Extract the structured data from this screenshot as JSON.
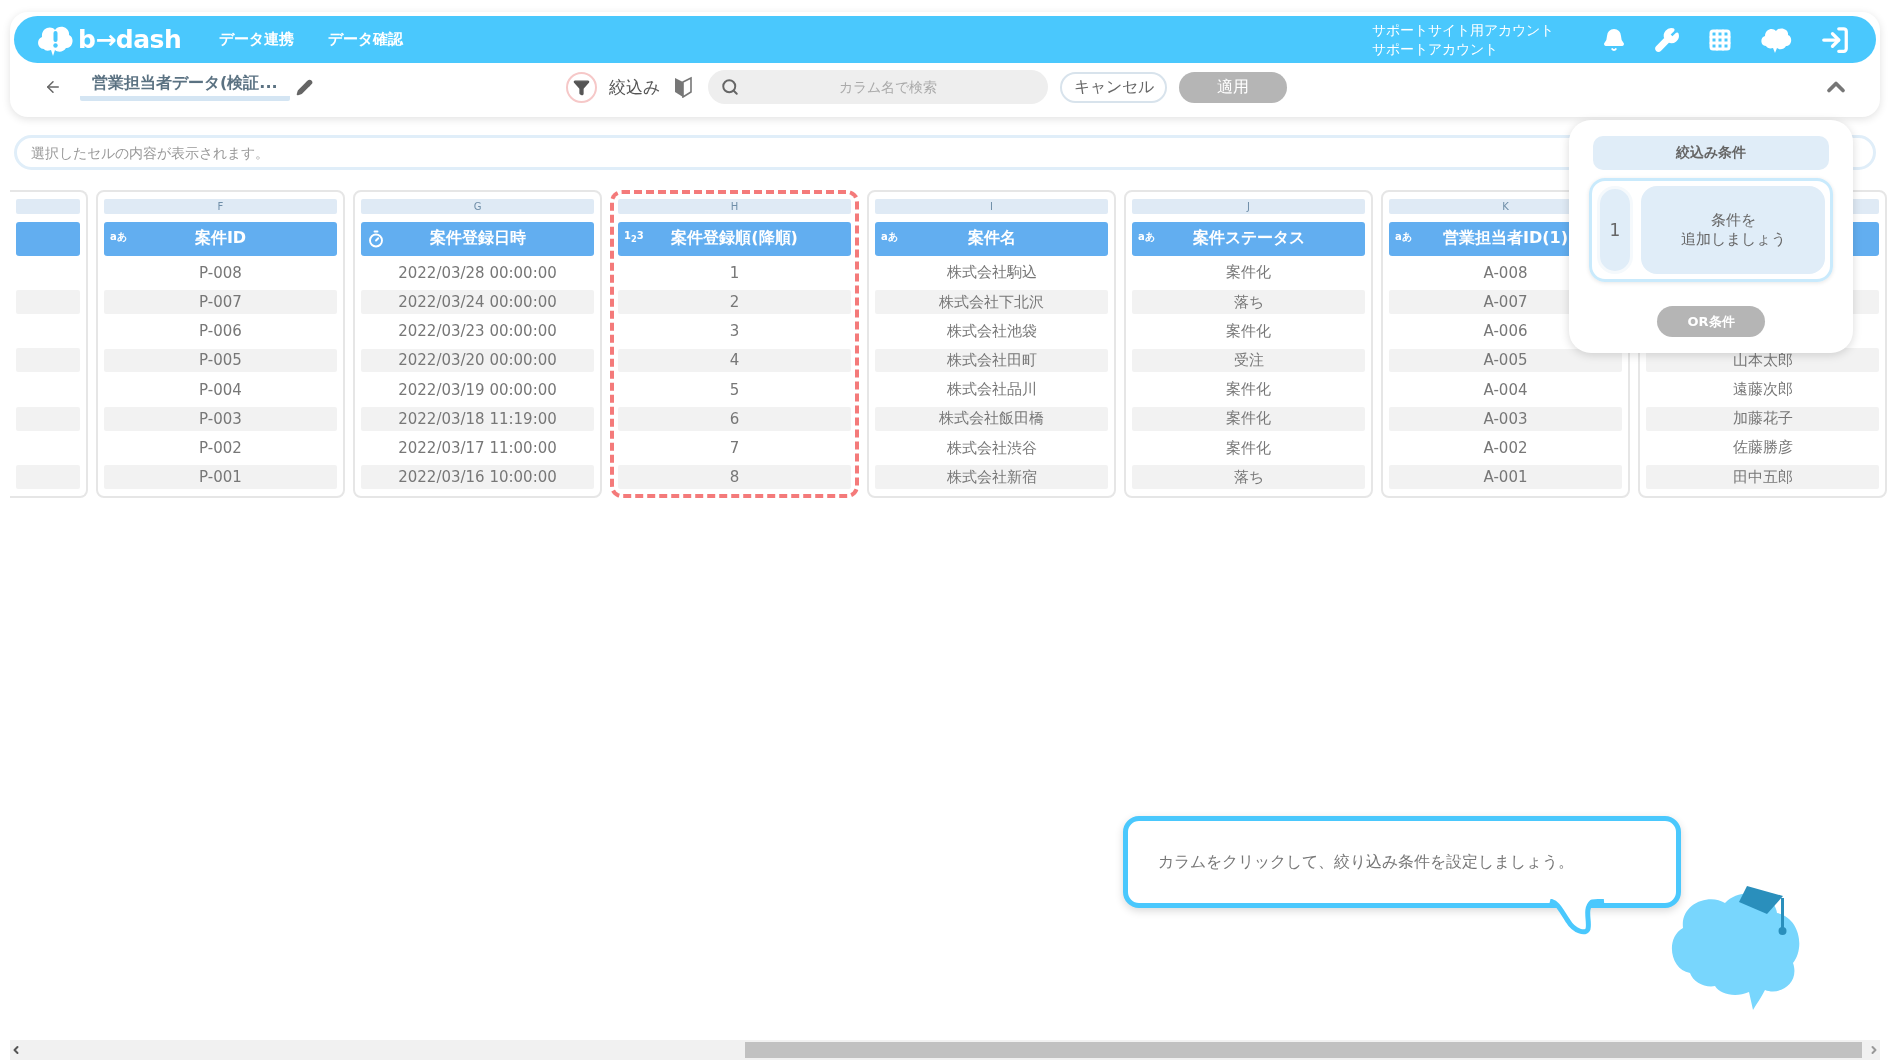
{
  "app_bar": {
    "logo": "b→dash",
    "nav": [
      {
        "label": "データ連携"
      },
      {
        "label": "データ確認"
      }
    ],
    "account": {
      "site": "サポートサイト用アカウント",
      "name": "サポートアカウント"
    }
  },
  "toolbar": {
    "title": "営業担当者データ(検証...",
    "filter_label": "絞込み",
    "search": {
      "placeholder": "カラム名で検索"
    },
    "buttons": [
      {
        "label": "キャンセル",
        "disabled": false
      },
      {
        "label": "適用",
        "disabled": true
      }
    ]
  },
  "cell_viewer": {
    "placeholder": "選択したセルの内容が表示されます。"
  },
  "columns": [
    {
      "letter": "F",
      "kind": "text",
      "type_mark": "aあ",
      "name": "案件ID",
      "selected": false,
      "cells": [
        "P-008",
        "P-007",
        "P-006",
        "P-005",
        "P-004",
        "P-003",
        "P-002",
        "P-001"
      ]
    },
    {
      "letter": "G",
      "kind": "datetime",
      "name": "案件登録日時",
      "selected": false,
      "cells": [
        "2022/03/28 00:00:00",
        "2022/03/24 00:00:00",
        "2022/03/23 00:00:00",
        "2022/03/20 00:00:00",
        "2022/03/19 00:00:00",
        "2022/03/18 11:19:00",
        "2022/03/17 11:00:00",
        "2022/03/16 10:00:00"
      ]
    },
    {
      "letter": "H",
      "kind": "number",
      "type_mark": "1$_{2}$3",
      "name": "案件登録順(降順)",
      "selected": true,
      "cells": [
        "1",
        "2",
        "3",
        "4",
        "5",
        "6",
        "7",
        "8"
      ]
    },
    {
      "letter": "I",
      "kind": "text",
      "type_mark": "aあ",
      "name": "案件名",
      "selected": false,
      "cells": [
        "株式会社駒込",
        "株式会社下北沢",
        "株式会社池袋",
        "株式会社田町",
        "株式会社品川",
        "株式会社飯田橋",
        "株式会社渋谷",
        "株式会社新宿"
      ]
    },
    {
      "letter": "J",
      "kind": "text",
      "type_mark": "aあ",
      "name": "案件ステータス",
      "selected": false,
      "cells": [
        "案件化",
        "落ち",
        "案件化",
        "受注",
        "案件化",
        "案件化",
        "案件化",
        "落ち"
      ]
    },
    {
      "letter": "K",
      "kind": "text",
      "type_mark": "aあ",
      "name": "営業担当者ID(1)",
      "selected": false,
      "cells": [
        "A-008",
        "A-007",
        "A-006",
        "A-005",
        "A-004",
        "A-003",
        "A-002",
        "A-001"
      ]
    },
    {
      "kind": "text",
      "selected": false,
      "cells": [
        "山本太郎",
        "遠藤次郎",
        "加藤花子",
        "佐藤勝彦",
        "田中五郎"
      ]
    }
  ],
  "filter_panel": {
    "title": "絞込み条件",
    "conditions": [
      {
        "number": "1",
        "lines": [
          "条件を",
          "追加しましょう"
        ]
      }
    ],
    "or_button": {
      "label": "OR条件",
      "disabled": true
    }
  },
  "hint": {
    "text": "カラムをクリックして、絞り込み条件を設定しましょう。"
  }
}
